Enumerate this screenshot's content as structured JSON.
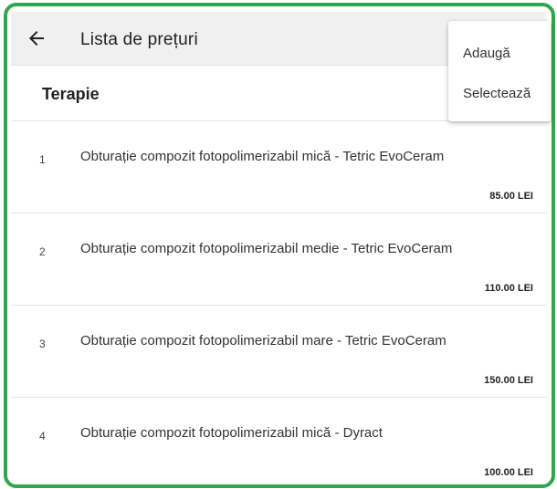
{
  "header": {
    "back_icon": "arrow-left-icon",
    "title": "Lista de prețuri"
  },
  "section": {
    "title": "Terapie"
  },
  "items": [
    {
      "number": "1",
      "name": "Obturație compozit fotopolimerizabil mică - Tetric EvoCeram",
      "price": "85.00 LEI"
    },
    {
      "number": "2",
      "name": "Obturație compozit fotopolimerizabil medie - Tetric EvoCeram",
      "price": "110.00 LEI"
    },
    {
      "number": "3",
      "name": "Obturație compozit fotopolimerizabil mare - Tetric EvoCeram",
      "price": "150.00 LEI"
    },
    {
      "number": "4",
      "name": "Obturație compozit fotopolimerizabil mică - Dyract",
      "price": "100.00 LEI"
    }
  ],
  "menu": {
    "add_label": "Adaugă",
    "select_label": "Selectează"
  },
  "colors": {
    "frame_border": "#2ea84a",
    "appbar_bg": "#f0f0f0"
  }
}
